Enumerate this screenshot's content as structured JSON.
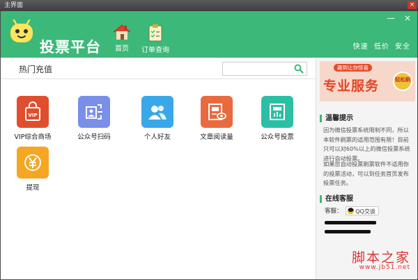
{
  "window": {
    "title": "主界面",
    "close_glyph": "×"
  },
  "header": {
    "app_title": "投票平台",
    "nav": [
      {
        "label": "首页",
        "icon": "home-icon"
      },
      {
        "label": "订单查询",
        "icon": "clipboard-icon"
      }
    ],
    "quick_links": "快速 低价 安全",
    "min_glyph": "—",
    "close_glyph": "×",
    "accent": "#3cb878"
  },
  "main": {
    "section_title": "热门充值",
    "search": {
      "value": "",
      "placeholder": ""
    },
    "tiles": [
      {
        "label": "VIP综合商场",
        "icon": "vip-bag-icon",
        "color": "#e04e2e"
      },
      {
        "label": "公众号扫码",
        "icon": "scan-icon",
        "color": "#7a8fe8"
      },
      {
        "label": "个人好友",
        "icon": "friends-icon",
        "color": "#3aa7e8"
      },
      {
        "label": "文章阅读量",
        "icon": "article-eye-icon",
        "color": "#e96a3f"
      },
      {
        "label": "公众号投票",
        "icon": "vote-chart-icon",
        "color": "#2bbfa6"
      },
      {
        "label": "提现",
        "icon": "yen-coin-icon",
        "color": "#f5a623"
      }
    ]
  },
  "side": {
    "banner": {
      "tagline": "趣到让你惊喜",
      "headline": "专业服务",
      "badge": "轻松刷"
    },
    "tips_title": "温馨提示",
    "tips_p1": "因为微信投票系统限制不同，所以本软件刷票的适用范围有限！目前只可以对60%以上的微信投票系统进行自动投票。",
    "tips_p2": "如果您自动投票刷票软件不适用你的投票活动，可以到任务首页发布投票任务。",
    "service_title": "在线客服",
    "service_label": "客服：",
    "qq_label": "QQ交谈",
    "watermark": "脚本之家",
    "watermark_url": "www.jb51.net"
  }
}
